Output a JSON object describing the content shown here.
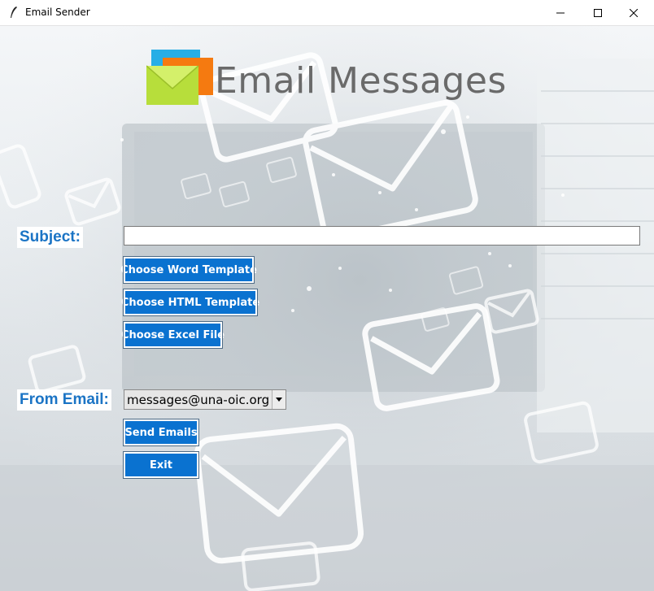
{
  "window": {
    "title": "Email Sender",
    "controls": {
      "minimize": "minimize-icon",
      "maximize": "maximize-icon",
      "close": "close-icon"
    }
  },
  "header": {
    "title": "Email Messages",
    "logo_icon": "email-stack-icon"
  },
  "form": {
    "subject_label": "Subject:",
    "subject_value": "",
    "choose_word_label": "Choose Word Template",
    "choose_html_label": "Choose HTML Template",
    "choose_excel_label": "Choose Excel File",
    "from_label": "From Email:",
    "from_selected": "messages@una-oic.org",
    "send_label": "Send Emails",
    "exit_label": "Exit"
  },
  "colors": {
    "accent": "#0a72d0",
    "label_text": "#1b74c5",
    "title_text": "#6a6a6a"
  }
}
